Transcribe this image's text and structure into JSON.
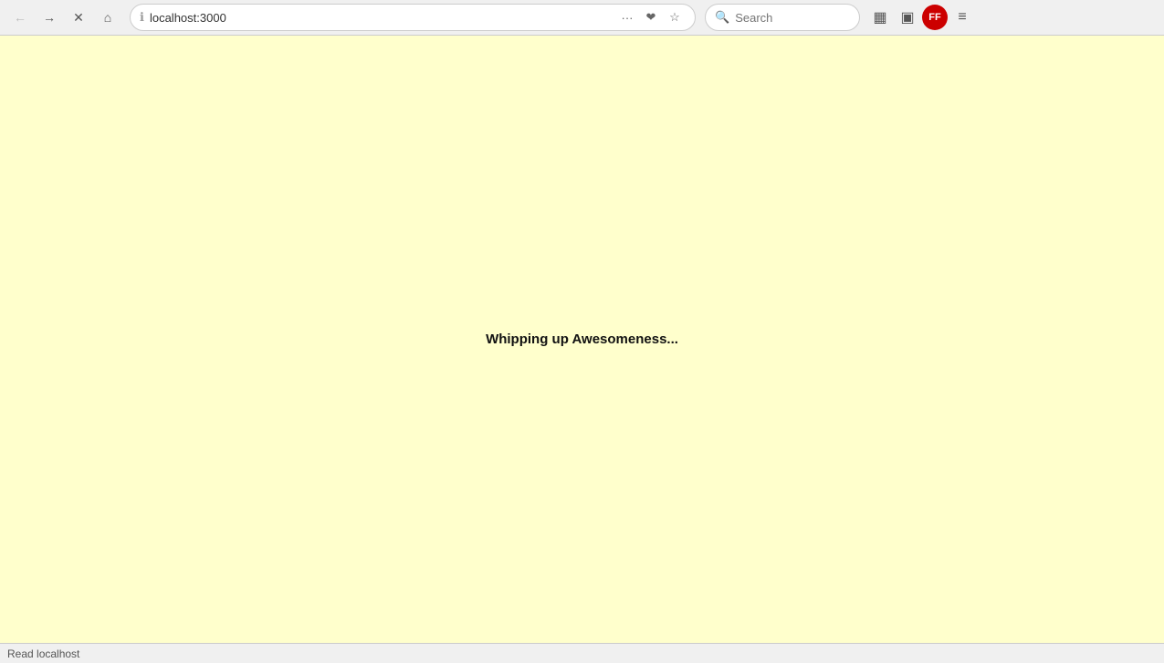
{
  "browser": {
    "nav": {
      "back_label": "←",
      "forward_label": "→",
      "close_label": "✕",
      "home_label": "⌂"
    },
    "address": {
      "url": "localhost:3000",
      "info_icon": "ℹ",
      "more_icon": "···",
      "bookmark_collection_icon": "❤",
      "star_icon": "☆"
    },
    "search": {
      "placeholder": "Search",
      "search_icon": "🔍"
    },
    "toolbar_right": {
      "library_icon": "▦",
      "sidebar_icon": "▣",
      "avatar_label": "FF",
      "menu_icon": "≡"
    }
  },
  "page": {
    "loading_text": "Whipping up Awesomeness...",
    "background_color": "#ffffcc"
  },
  "status_bar": {
    "text": "Read localhost"
  }
}
